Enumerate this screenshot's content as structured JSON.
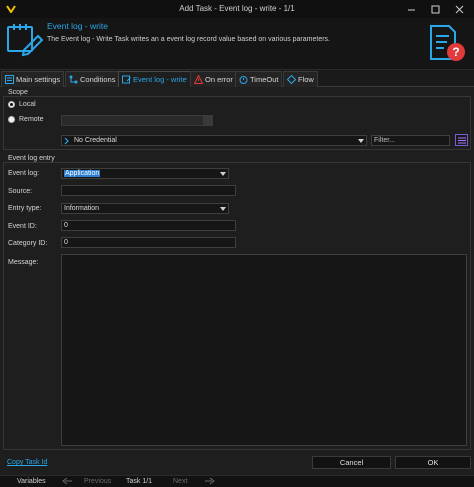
{
  "window": {
    "title": "Add Task - Event log - write - 1/1"
  },
  "header": {
    "title": "Event log - write",
    "description": "The Event log - Write Task writes an a event log record value based on various parameters."
  },
  "tabs": [
    {
      "label": "Main settings",
      "icon": "main-settings-icon"
    },
    {
      "label": "Conditions",
      "icon": "conditions-icon"
    },
    {
      "label": "Event log - write",
      "icon": "event-log-icon"
    },
    {
      "label": "On error",
      "icon": "warning-icon"
    },
    {
      "label": "TimeOut",
      "icon": "stopwatch-icon"
    },
    {
      "label": "Flow",
      "icon": "flow-icon"
    }
  ],
  "scope": {
    "group_label": "Scope",
    "local_label": "Local",
    "remote_label": "Remote",
    "remote_value": "",
    "credential_value": "No Credential",
    "filter_placeholder": "Filter..."
  },
  "entry": {
    "group_label": "Event log entry",
    "event_log_label": "Event log:",
    "event_log_value": "Application",
    "source_label": "Source:",
    "source_value": "",
    "entry_type_label": "Entry type:",
    "entry_type_value": "Information",
    "event_id_label": "Event ID:",
    "event_id_value": "0",
    "category_id_label": "Category ID:",
    "category_id_value": "0",
    "message_label": "Message:",
    "message_value": ""
  },
  "footer": {
    "copy_link": "Copy Task Id",
    "cancel_label": "Cancel",
    "ok_label": "OK"
  },
  "statusbar": {
    "variables_label": "Variables",
    "previous_label": "Previous",
    "task_counter": "Task 1/1",
    "next_label": "Next"
  },
  "colors": {
    "accent": "#2aa7e8",
    "error": "#e03a3a",
    "background": "#1e1e1e"
  }
}
